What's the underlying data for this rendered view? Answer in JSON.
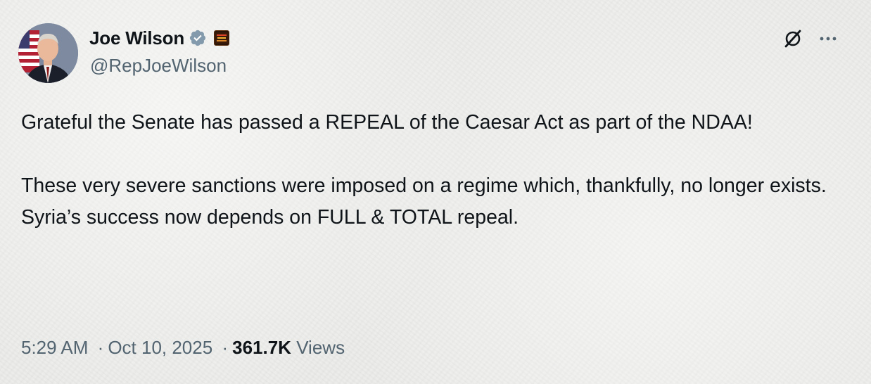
{
  "author": {
    "display_name": "Joe Wilson",
    "handle": "@RepJoeWilson",
    "verified": true,
    "verified_color": "#829aab",
    "affiliate_badge": "flag-badge-icon"
  },
  "tweet": {
    "paragraphs": [
      "Grateful the Senate has passed a REPEAL of the Caesar Act as part of the NDAA!",
      "These very severe sanctions were imposed on a regime which, thankfully, no longer exists. Syria’s success now depends on FULL & TOTAL repeal."
    ],
    "time": "5:29 AM",
    "separator": "·",
    "date": "Oct 10, 2025",
    "views_count": "361.7K",
    "views_label": "Views"
  },
  "actions": {
    "grok_icon": "grok-icon",
    "more_icon": "more-icon"
  },
  "colors": {
    "text_primary": "#0f1419",
    "text_secondary": "#536471",
    "background": "#ececea"
  }
}
